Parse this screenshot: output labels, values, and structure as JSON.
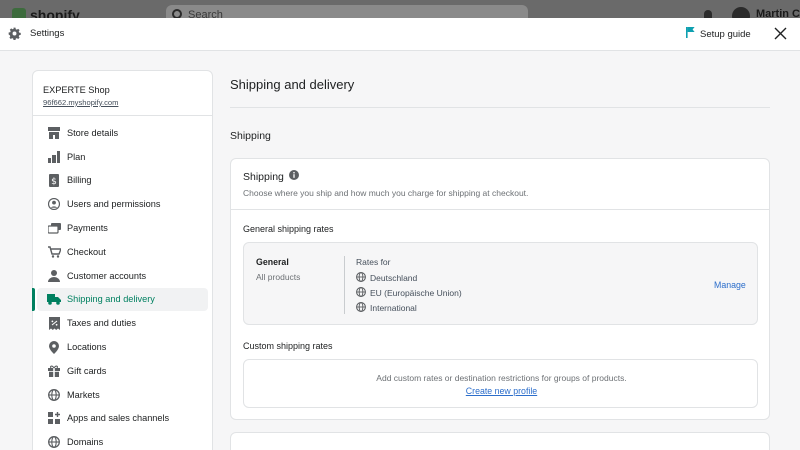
{
  "colors": {
    "accent": "#008060",
    "link": "#2c6ecb",
    "setup_flag": "#0ea0b0"
  },
  "topbar": {
    "brand": "shopify",
    "search_placeholder": "Search",
    "user": "Martin C"
  },
  "header": {
    "title": "Settings",
    "setup_guide": "Setup guide"
  },
  "shop": {
    "name": "EXPERTE Shop",
    "url": "96f662.myshopify.com"
  },
  "sidebar": {
    "items": [
      {
        "label": "Store details",
        "icon": "store-icon"
      },
      {
        "label": "Plan",
        "icon": "plan-icon"
      },
      {
        "label": "Billing",
        "icon": "billing-icon"
      },
      {
        "label": "Users and permissions",
        "icon": "user-icon"
      },
      {
        "label": "Payments",
        "icon": "payments-icon"
      },
      {
        "label": "Checkout",
        "icon": "cart-icon"
      },
      {
        "label": "Customer accounts",
        "icon": "person-icon"
      },
      {
        "label": "Shipping and delivery",
        "icon": "truck-icon",
        "active": true
      },
      {
        "label": "Taxes and duties",
        "icon": "taxes-icon"
      },
      {
        "label": "Locations",
        "icon": "location-icon"
      },
      {
        "label": "Gift cards",
        "icon": "gift-icon"
      },
      {
        "label": "Markets",
        "icon": "globe-icon"
      },
      {
        "label": "Apps and sales channels",
        "icon": "apps-icon"
      },
      {
        "label": "Domains",
        "icon": "globe-icon"
      }
    ]
  },
  "main": {
    "page_title": "Shipping and delivery",
    "section_title": "Shipping",
    "card": {
      "title": "Shipping",
      "description": "Choose where you ship and how much you charge for shipping at checkout.",
      "general_rates_title": "General shipping rates",
      "profile": {
        "name": "General",
        "products": "All products",
        "rates_for": "Rates for",
        "zones": [
          "Deutschland",
          "EU (Europäische Union)",
          "International"
        ],
        "manage": "Manage"
      },
      "custom_rates_title": "Custom shipping rates",
      "custom_text": "Add custom rates or destination restrictions for groups of products.",
      "create_link": "Create new profile"
    }
  }
}
